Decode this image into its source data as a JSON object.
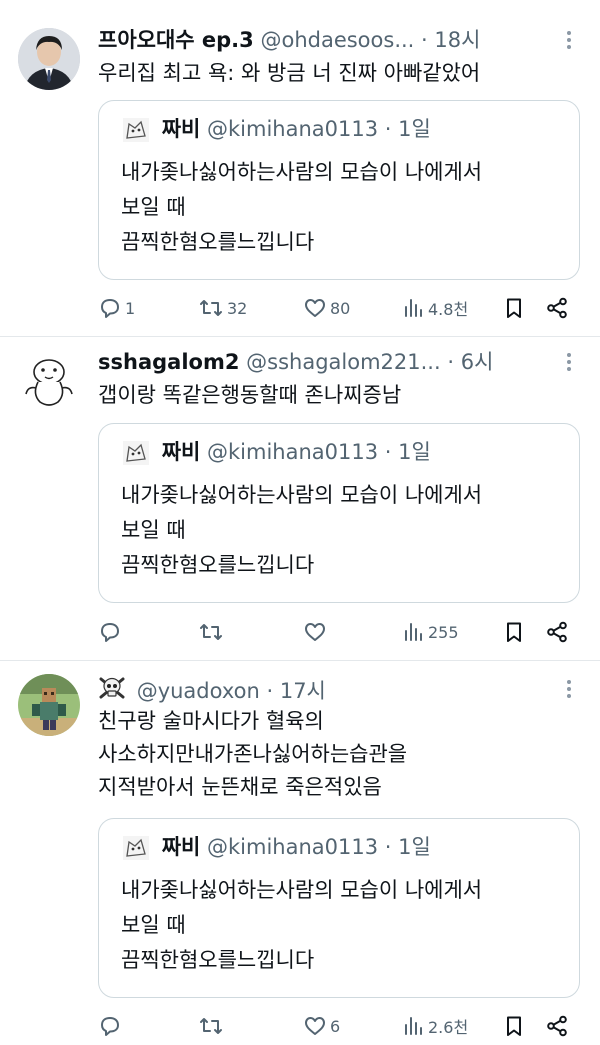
{
  "quote": {
    "name": "짜비",
    "handle": "@kimihana0113",
    "sep": "·",
    "time": "1일",
    "lines": [
      "내가좆나싫어하는사람의 모습이 나에게서",
      "보일 때",
      "끔찍한혐오를느낍니다"
    ]
  },
  "tweets": [
    {
      "name": "프아오대수 ep.3",
      "handle": "@ohdaesoos...",
      "sep": "·",
      "time": "18시",
      "lines": [
        "우리집 최고 욕: 와 방금 너 진짜 아빠같았어"
      ],
      "reply_count": "1",
      "retweet_count": "32",
      "like_count": "80",
      "view_count": "4.8천"
    },
    {
      "name": "sshagalom2",
      "handle": "@sshagalom221...",
      "sep": "·",
      "time": "6시",
      "lines": [
        "갭이랑 똑같은행동할때 존나찌증남"
      ],
      "reply_count": "",
      "retweet_count": "",
      "like_count": "",
      "view_count": "255"
    },
    {
      "name": "",
      "handle": "@yuadoxon",
      "sep": "·",
      "time": "17시",
      "lines": [
        "친구랑 술마시다가 혈육의",
        "사소하지만내가존나싫어하는습관을",
        "지적받아서 눈뜬채로 죽은적있음"
      ],
      "reply_count": "",
      "retweet_count": "",
      "like_count": "6",
      "view_count": "2.6천"
    }
  ],
  "icons": {
    "reply": "reply-icon",
    "retweet": "retweet-icon",
    "like": "heart-icon",
    "views": "views-icon",
    "bookmark": "bookmark-icon",
    "share": "share-icon",
    "more": "more-icon",
    "skull": "skull-crossbones-icon"
  },
  "colors": {
    "text": "#0f1419",
    "secondary": "#536471",
    "border": "#cfd9de",
    "divider": "#e4e8eb"
  }
}
